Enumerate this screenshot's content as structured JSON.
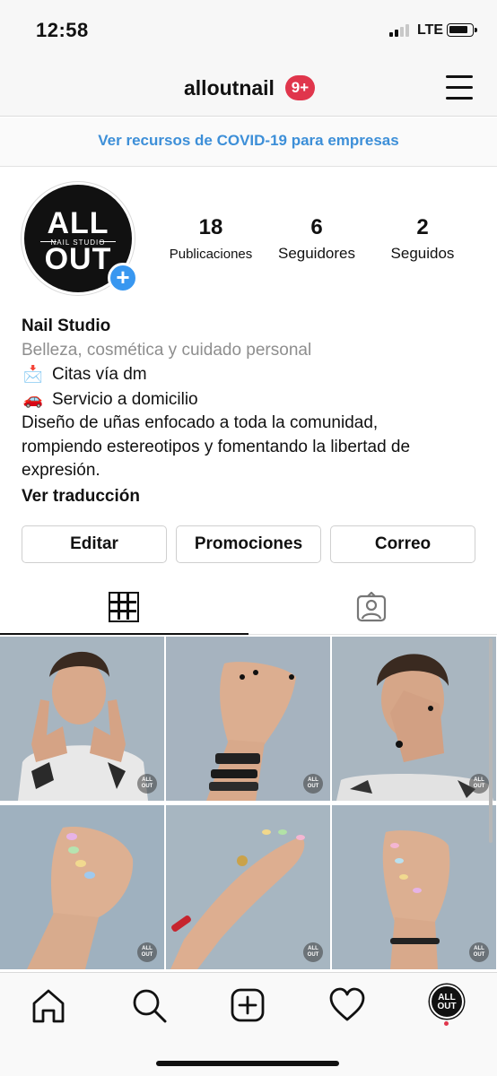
{
  "status_bar": {
    "time": "12:58",
    "network": "LTE"
  },
  "header": {
    "username": "alloutnail",
    "notification_badge": "9+",
    "menu_icon": "hamburger-menu-icon"
  },
  "covid_banner": {
    "link_text": "Ver recursos de COVID-19 para empresas"
  },
  "profile": {
    "avatar_logo_top": "ALL",
    "avatar_logo_sub": "NAIL STUDIO",
    "avatar_logo_bottom": "OUT",
    "stats": [
      {
        "value": "18",
        "label": "Publicaciones"
      },
      {
        "value": "6",
        "label": "Seguidores"
      },
      {
        "value": "2",
        "label": "Seguidos"
      }
    ]
  },
  "bio": {
    "name": "Nail Studio",
    "category": "Belleza, cosmética y cuidado personal",
    "line1_icon": "envelope-emoji",
    "line1_emoji": "📩",
    "line1_text": "Citas vía dm",
    "line2_icon": "car-emoji",
    "line2_emoji": "🚗",
    "line2_text": "Servicio a domicilio",
    "description_line1": "Diseño de uñas enfocado a toda la comunidad,",
    "description_line2": "rompiendo estereotipos y fomentando la libertad de",
    "description_line3": "expresión.",
    "translate_link": "Ver traducción"
  },
  "actions": {
    "edit": "Editar",
    "promotions": "Promociones",
    "email": "Correo"
  },
  "tabs": [
    {
      "icon": "grid-icon",
      "active": true
    },
    {
      "icon": "tagged-icon",
      "active": false
    }
  ],
  "posts": [
    {
      "description": "Portrait of man with painted nails making rock hand signs",
      "watermark": "ALL OUT"
    },
    {
      "description": "Raised hand with black nail designs and bracelets",
      "watermark": "ALL OUT"
    },
    {
      "description": "Man posing with hand over face showing nail art",
      "watermark": "ALL OUT"
    },
    {
      "description": "Hand with pastel rainbow nails",
      "watermark": "ALL OUT"
    },
    {
      "description": "Hand with colorful nails and ring",
      "watermark": "ALL OUT"
    },
    {
      "description": "Fist with pastel nail designs",
      "watermark": "ALL OUT"
    }
  ],
  "bottom_nav": [
    {
      "icon": "home-icon"
    },
    {
      "icon": "search-icon"
    },
    {
      "icon": "new-post-icon"
    },
    {
      "icon": "heart-icon"
    },
    {
      "icon": "profile-avatar-icon"
    }
  ],
  "colors": {
    "accent_blue": "#3897f0",
    "link_blue": "#3d8fd8",
    "badge_red": "#e0364c",
    "secondary_text": "#8e8e8e"
  }
}
